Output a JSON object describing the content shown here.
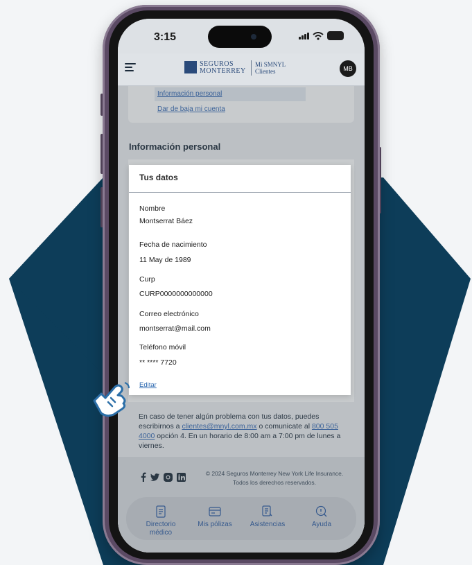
{
  "status_bar": {
    "time": "3:15"
  },
  "header": {
    "logo_top": "SEGUROS",
    "logo_bottom": "MONTERREY",
    "portal_top": "Mi SMNYL",
    "portal_bottom": "Clientes",
    "avatar_initials": "MB"
  },
  "account_menu": {
    "item_personal": "Información personal",
    "item_unsubscribe": "Dar de baja mi cuenta"
  },
  "section_title": "Información personal",
  "modal": {
    "title": "Tus datos",
    "name_label": "Nombre",
    "name_value": "Montserrat Báez",
    "birth_label": "Fecha de nacimiento",
    "birth_value": "11 May de 1989",
    "curp_label": "Curp",
    "curp_value": "CURP0000000000000",
    "email_label": "Correo electrónico",
    "email_value": "montserrat@mail.com",
    "phone_label": "Teléfono móvil",
    "phone_value": "** **** 7720",
    "edit_label": "Editar"
  },
  "help": {
    "text_1": "En caso de tener algún problema con tus datos, puedes escribirnos a ",
    "email_link": "clientes@mnyl.com.mx",
    "text_2": " o comunicate al ",
    "phone_link": "800 505 4000",
    "text_3": " opción 4. En un horario de 8:00 am a 7:00 pm de lunes a viernes."
  },
  "footer": {
    "copyright": "© 2024 Seguros Monterrey New York Life Insurance. Todos los derechos reservados."
  },
  "tabbar": {
    "tab_directory": "Directorio médico",
    "tab_policies": "Mis pólizas",
    "tab_assist": "Asistencias",
    "tab_help": "Ayuda"
  },
  "colors": {
    "background": "#f3f5f7",
    "diamond": "#0d3d59",
    "phone_frame": "#5b4a64",
    "link": "#2d69b0",
    "brand": "#2a4a7a"
  },
  "icons": [
    "menu-icon",
    "signal-icon",
    "wifi-icon",
    "battery-icon",
    "facebook-icon",
    "twitter-icon",
    "instagram-icon",
    "linkedin-icon",
    "directory-icon",
    "policy-card-icon",
    "assistance-icon",
    "help-icon",
    "tap-hand-icon"
  ]
}
